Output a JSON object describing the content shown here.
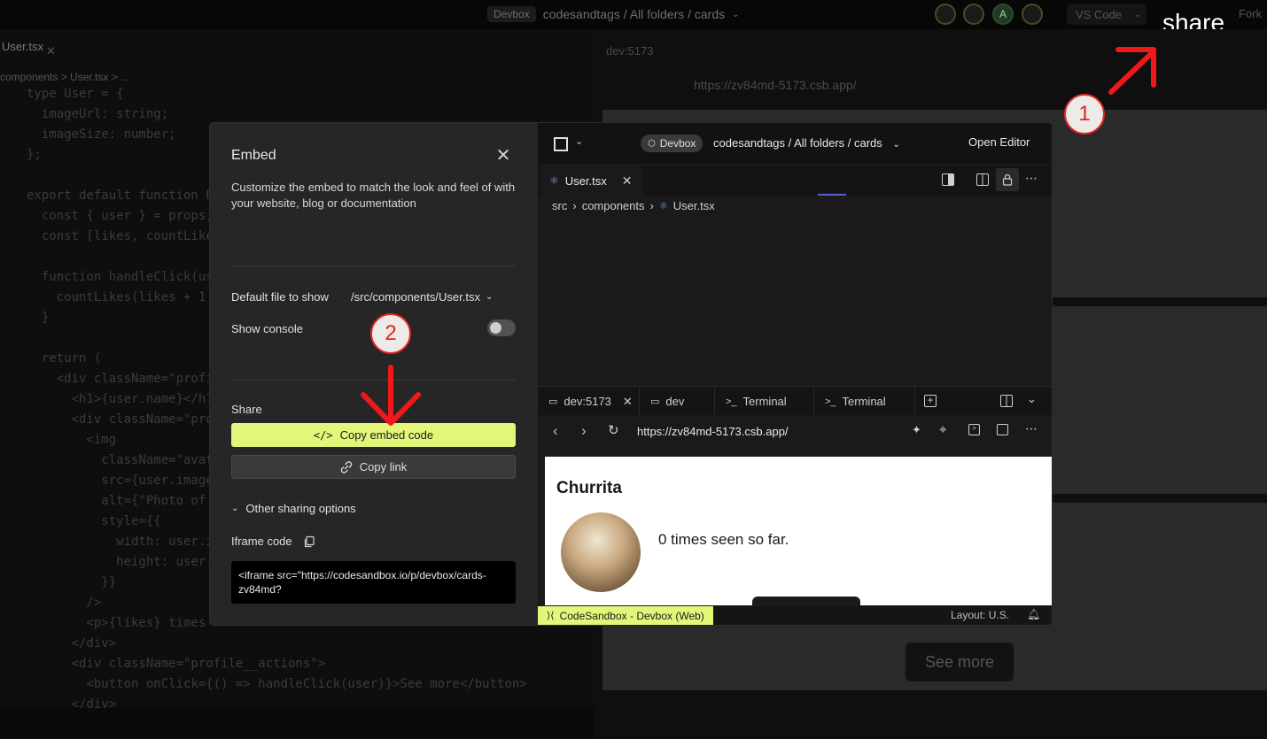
{
  "annotations": {
    "share_caption": "share",
    "step1": "1",
    "step2": "2"
  },
  "topbar": {
    "devbox_badge": "Devbox",
    "path": "codesandtags / All folders / cards",
    "vs_code_label": "VS Code",
    "fork_label": "Fork",
    "avatar_letter": "A"
  },
  "background": {
    "file_tab": "User.tsx",
    "breadcrumb": "components > User.tsx > ...",
    "dev_tab": "dev:5173",
    "url": "https://zv84md-5173.csb.app/",
    "see_more": "See more",
    "code_lines": [
      "type User = {",
      "  imageUrl: string;",
      "  imageSize: number;",
      "};",
      "",
      "export default function P",
      "  const { user } = props;",
      "  const [likes, countLike",
      "",
      "  function handleClick(us",
      "    countLikes(likes + 1",
      "  }",
      "",
      "  return (",
      "    <div className=\"profi",
      "      <h1>{user.name}</h1",
      "      <div className=\"pro",
      "        <img",
      "          className=\"avat",
      "          src={user.image",
      "          alt={\"Photo of",
      "          style={{",
      "            width: user.i",
      "            height: user.",
      "          }}",
      "        />",
      "        <p>{likes} times",
      "      </div>",
      "      <div className=\"profile__actions\">",
      "        <button onClick={() => handleClick(user)}>See more</button>",
      "      </div>"
    ]
  },
  "embed": {
    "title": "Embed",
    "description": "Customize the embed to match the look and feel of with your website, blog or documentation",
    "default_file_label": "Default file to show",
    "default_file_value": "/src/components/User.tsx",
    "show_console_label": "Show console",
    "show_console_on": false,
    "share_label": "Share",
    "copy_embed_label": "Copy embed code",
    "copy_link_label": "Copy link",
    "other_options_label": "Other sharing options",
    "iframe_label": "Iframe code",
    "iframe_code": "<iframe src=\"https://codesandbox.io/p/devbox/cards-zv84md?"
  },
  "preview": {
    "devbox_badge": "Devbox",
    "path": "codesandtags / All folders / cards",
    "open_editor": "Open Editor",
    "file_tab": "User.tsx",
    "breadcrumb": [
      "src",
      "components",
      "User.tsx"
    ],
    "terminal_tabs": [
      "dev:5173",
      "dev",
      "Terminal",
      "Terminal"
    ],
    "url": "https://zv84md-5173.csb.app/",
    "profile_name": "Churrita",
    "seen_text": "0 times seen so far.",
    "status_badge": "CodeSandbox - Devbox (Web)",
    "layout": "Layout: U.S."
  },
  "colors": {
    "accent": "#e3f67a",
    "annotation_red": "#e52424"
  }
}
